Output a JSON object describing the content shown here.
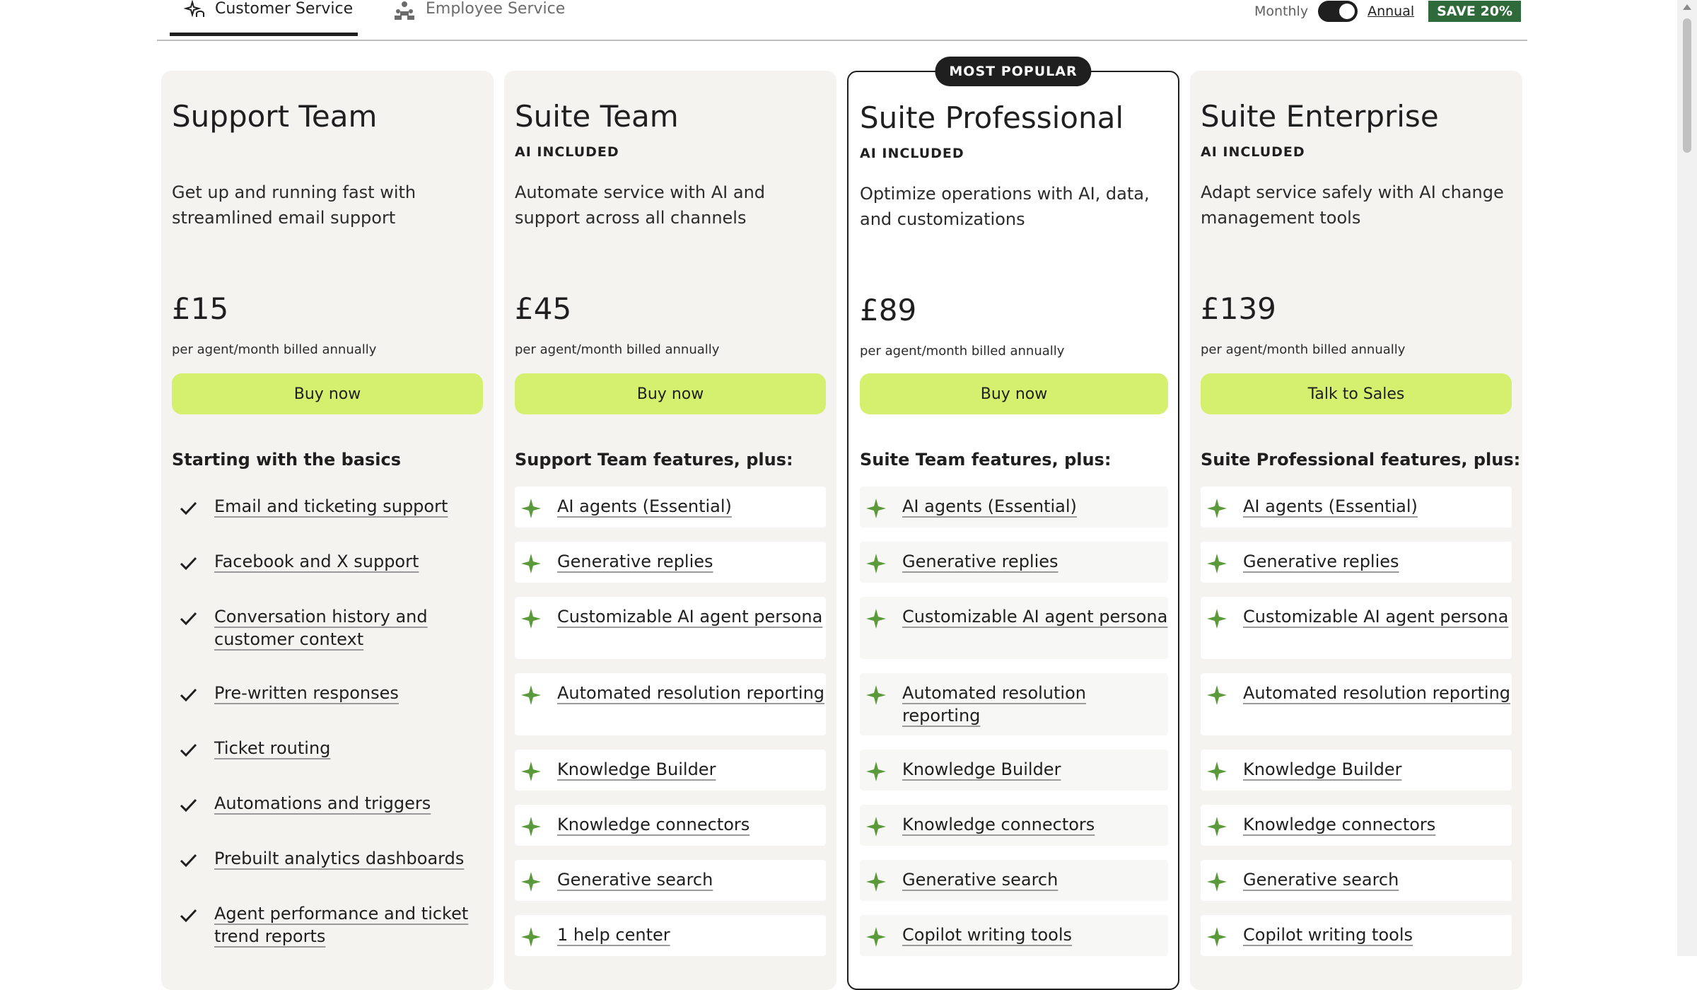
{
  "tabs": [
    {
      "label": "Customer Service",
      "icon": "sparkle-headset-icon",
      "active": true
    },
    {
      "label": "Employee Service",
      "icon": "people-icon",
      "active": false
    }
  ],
  "billing": {
    "monthly": "Monthly",
    "annual": "Annual",
    "save": "SAVE 20%"
  },
  "colors": {
    "accent": "#d4f06e",
    "sparkle": "#5a9a3a",
    "save_bg": "#2f6b3a",
    "card_bg": "#f4f3ef"
  },
  "plans": [
    {
      "name": "Support Team",
      "ai": "",
      "desc": "Get up and running fast with streamlined email support",
      "price": "£15",
      "billed": "per agent/month billed annually",
      "cta": "Buy now",
      "feature_head": "Starting with the basics",
      "features": [
        "Email and ticketing support",
        "Facebook and X support",
        "Conversation history and customer context",
        "Pre-written responses",
        "Ticket routing",
        "Automations and triggers",
        "Prebuilt analytics dashboards",
        "Agent performance and ticket trend reports"
      ]
    },
    {
      "name": "Suite Team",
      "ai": "AI INCLUDED",
      "desc": "Automate service with AI and support across all channels",
      "price": "£45",
      "billed": "per agent/month billed annually",
      "cta": "Buy now",
      "feature_head": "Support Team features, plus:",
      "features": [
        "AI agents (Essential)",
        "Generative replies",
        "Customizable AI agent persona",
        "Automated resolution reporting",
        "Knowledge Builder",
        "Knowledge connectors",
        "Generative search",
        "1 help center"
      ]
    },
    {
      "name": "Suite Professional",
      "badge": "MOST POPULAR",
      "ai": "AI INCLUDED",
      "desc": "Optimize operations with AI, data, and customizations",
      "price": "£89",
      "billed": "per agent/month billed annually",
      "cta": "Buy now",
      "feature_head": "Suite Team features, plus:",
      "features": [
        "AI agents (Essential)",
        "Generative replies",
        "Customizable AI agent persona",
        "Automated resolution reporting",
        "Knowledge Builder",
        "Knowledge connectors",
        "Generative search",
        "Copilot writing tools"
      ]
    },
    {
      "name": "Suite Enterprise",
      "ai": "AI INCLUDED",
      "desc": "Adapt service safely with AI change management tools",
      "price": "£139",
      "billed": "per agent/month billed annually",
      "cta": "Talk to Sales",
      "feature_head": "Suite Professional features, plus:",
      "features": [
        "AI agents (Essential)",
        "Generative replies",
        "Customizable AI agent persona",
        "Automated resolution reporting",
        "Knowledge Builder",
        "Knowledge connectors",
        "Generative search",
        "Copilot writing tools"
      ]
    }
  ]
}
